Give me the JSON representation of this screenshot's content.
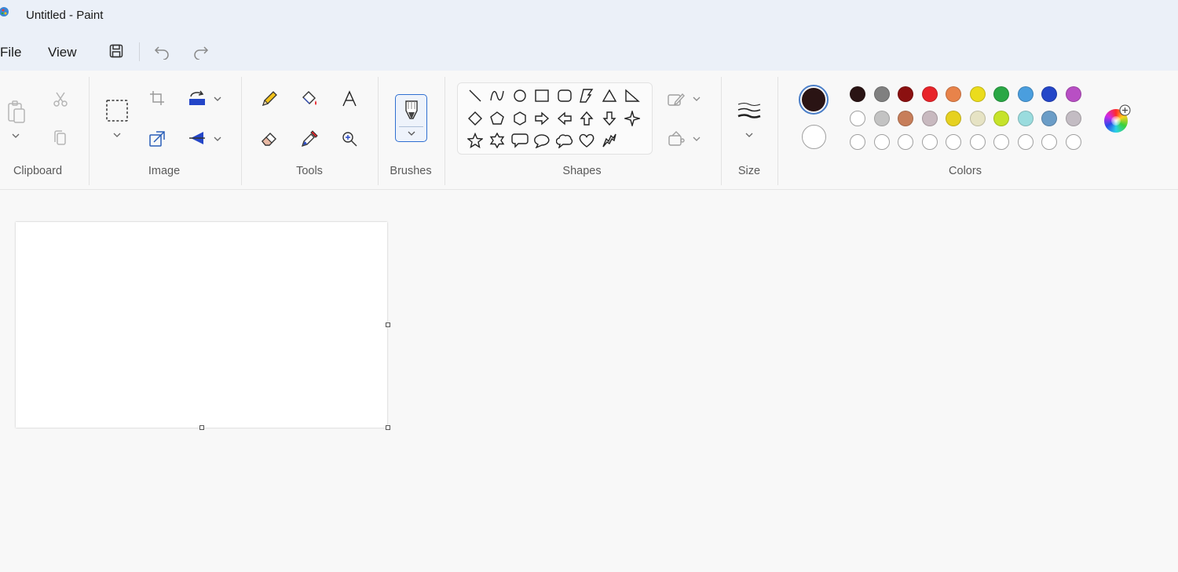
{
  "window": {
    "title": "Untitled - Paint"
  },
  "menu": {
    "file": "File",
    "view": "View"
  },
  "quick_access": [
    "save-icon",
    "undo-icon",
    "redo-icon"
  ],
  "ribbon": {
    "groups": {
      "clipboard": "Clipboard",
      "image": "Image",
      "tools": "Tools",
      "brushes": "Brushes",
      "shapes": "Shapes",
      "size": "Size",
      "colors": "Colors"
    }
  },
  "shapes": [
    "line",
    "curve",
    "oval",
    "rectangle",
    "rounded-rectangle",
    "polygon",
    "triangle",
    "right-triangle",
    "diamond",
    "pentagon",
    "hexagon",
    "right-arrow",
    "left-arrow",
    "up-arrow",
    "down-arrow",
    "four-point-star",
    "five-point-star",
    "six-point-star",
    "rounded-callout",
    "oval-callout",
    "cloud-callout",
    "heart",
    "lightning"
  ],
  "colors": {
    "primary": "#2a1414",
    "secondary": "#ffffff",
    "row1": [
      "#2a1414",
      "#808080",
      "#8b1010",
      "#e8242a",
      "#e8834a",
      "#ebdc1c",
      "#2aa745",
      "#4a9ede",
      "#2446c8",
      "#b84fc4"
    ],
    "row2": [
      "#ffffff",
      "#c3c3c3",
      "#c77e5a",
      "#c8b9bf",
      "#e6d120",
      "#e6e3c4",
      "#c6e32a",
      "#9adcde",
      "#6b9dc7",
      "#c3bcc3"
    ],
    "row3": [
      "#ffffff",
      "#ffffff",
      "#ffffff",
      "#ffffff",
      "#ffffff",
      "#ffffff",
      "#ffffff",
      "#ffffff",
      "#ffffff",
      "#ffffff"
    ]
  }
}
